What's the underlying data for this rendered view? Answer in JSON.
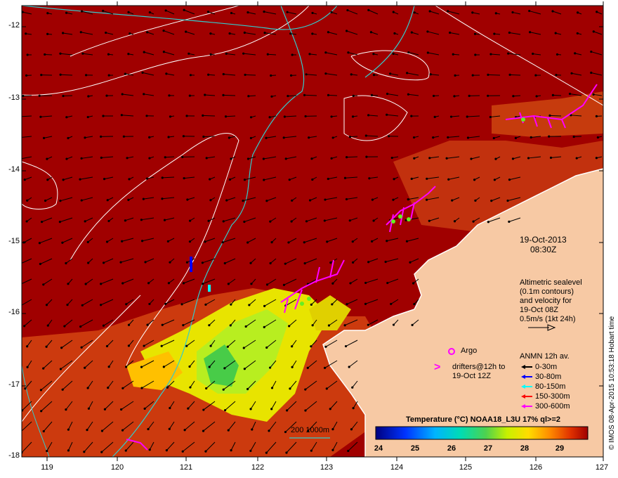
{
  "map": {
    "date": "19-Oct-2013",
    "time": "08:30Z",
    "altimetry": [
      "Altimetric sealevel",
      "(0.1m contours)",
      "and velocity for",
      "19-Oct 08Z",
      "0.5m/s (1kt 24h)"
    ],
    "argo_label": "Argo",
    "drifters_label": [
      "drifters@12h to",
      "19-Oct 12Z"
    ],
    "anmn_title": "ANMN 12h av.",
    "anmn_items": [
      {
        "label": "0-30m",
        "color": "#000000"
      },
      {
        "label": "30-80m",
        "color": "#0000ff"
      },
      {
        "label": "80-150m",
        "color": "#00ffff"
      },
      {
        "label": "150-300m",
        "color": "#ff0000"
      },
      {
        "label": "300-600m",
        "color": "#ff00ff"
      }
    ],
    "depth_contours_label": "200 1000m",
    "colorbar_title": "Temperature (°C) NOAA18_L3U 17% ql>=2",
    "colorbar_ticks": [
      "24",
      "25",
      "26",
      "27",
      "28",
      "29"
    ],
    "credit": "© IMOS 08-Apr-2015 10:53:18 Hobart time",
    "lat_ticks": [
      "-12",
      "-13",
      "-14",
      "-15",
      "-16",
      "-17",
      "-18"
    ],
    "lon_ticks": [
      "119",
      "120",
      "121",
      "122",
      "123",
      "124",
      "125",
      "126",
      "127"
    ],
    "colors": {
      "sea_hot": "#a00000",
      "land": "#f7c9a4",
      "contour": "#33cccc"
    }
  }
}
